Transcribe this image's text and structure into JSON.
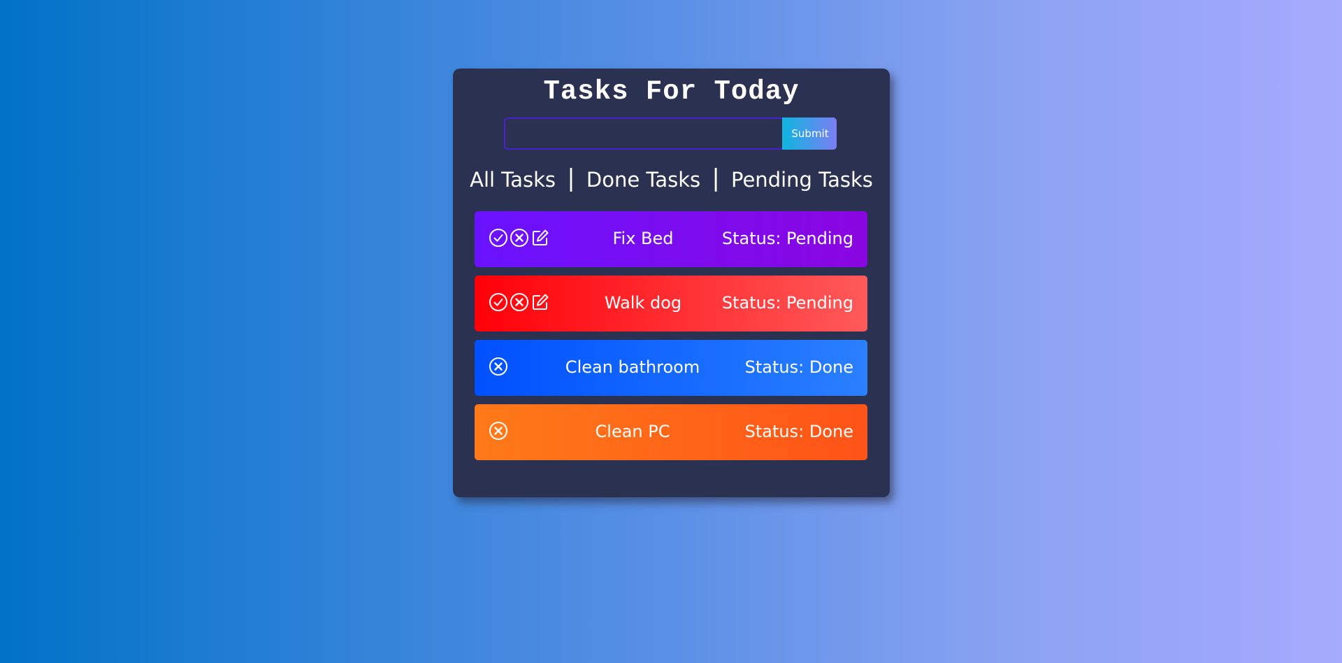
{
  "header": {
    "title": "Tasks For Today"
  },
  "form": {
    "input_value": "",
    "input_placeholder": "",
    "submit_label": "Submit"
  },
  "filters": {
    "all": "All Tasks",
    "done": "Done Tasks",
    "pending": "Pending Tasks",
    "separator": "|"
  },
  "tasks": [
    {
      "name": "Fix Bed",
      "status": "Status: Pending",
      "actions": [
        "check-circle-icon",
        "x-circle-icon",
        "edit-icon"
      ],
      "gradient": [
        "#6a12ff",
        "#8a06e0"
      ]
    },
    {
      "name": "Walk dog",
      "status": "Status: Pending",
      "actions": [
        "check-circle-icon",
        "x-circle-icon",
        "edit-icon"
      ],
      "gradient": [
        "#ff0008",
        "#ff5a5a"
      ]
    },
    {
      "name": "Clean bathroom",
      "status": "Status: Done",
      "actions": [
        "x-circle-icon"
      ],
      "gradient": [
        "#0050ff",
        "#2a80ff"
      ]
    },
    {
      "name": "Clean PC",
      "status": "Status: Done",
      "actions": [
        "x-circle-icon"
      ],
      "gradient": [
        "#ff7a18",
        "#ff5318"
      ]
    }
  ],
  "colors": {
    "card_background": "#2b3150",
    "input_border": "#4a1fd0",
    "submit_gradient": [
      "#10b4e0",
      "#7b7ef2"
    ]
  }
}
